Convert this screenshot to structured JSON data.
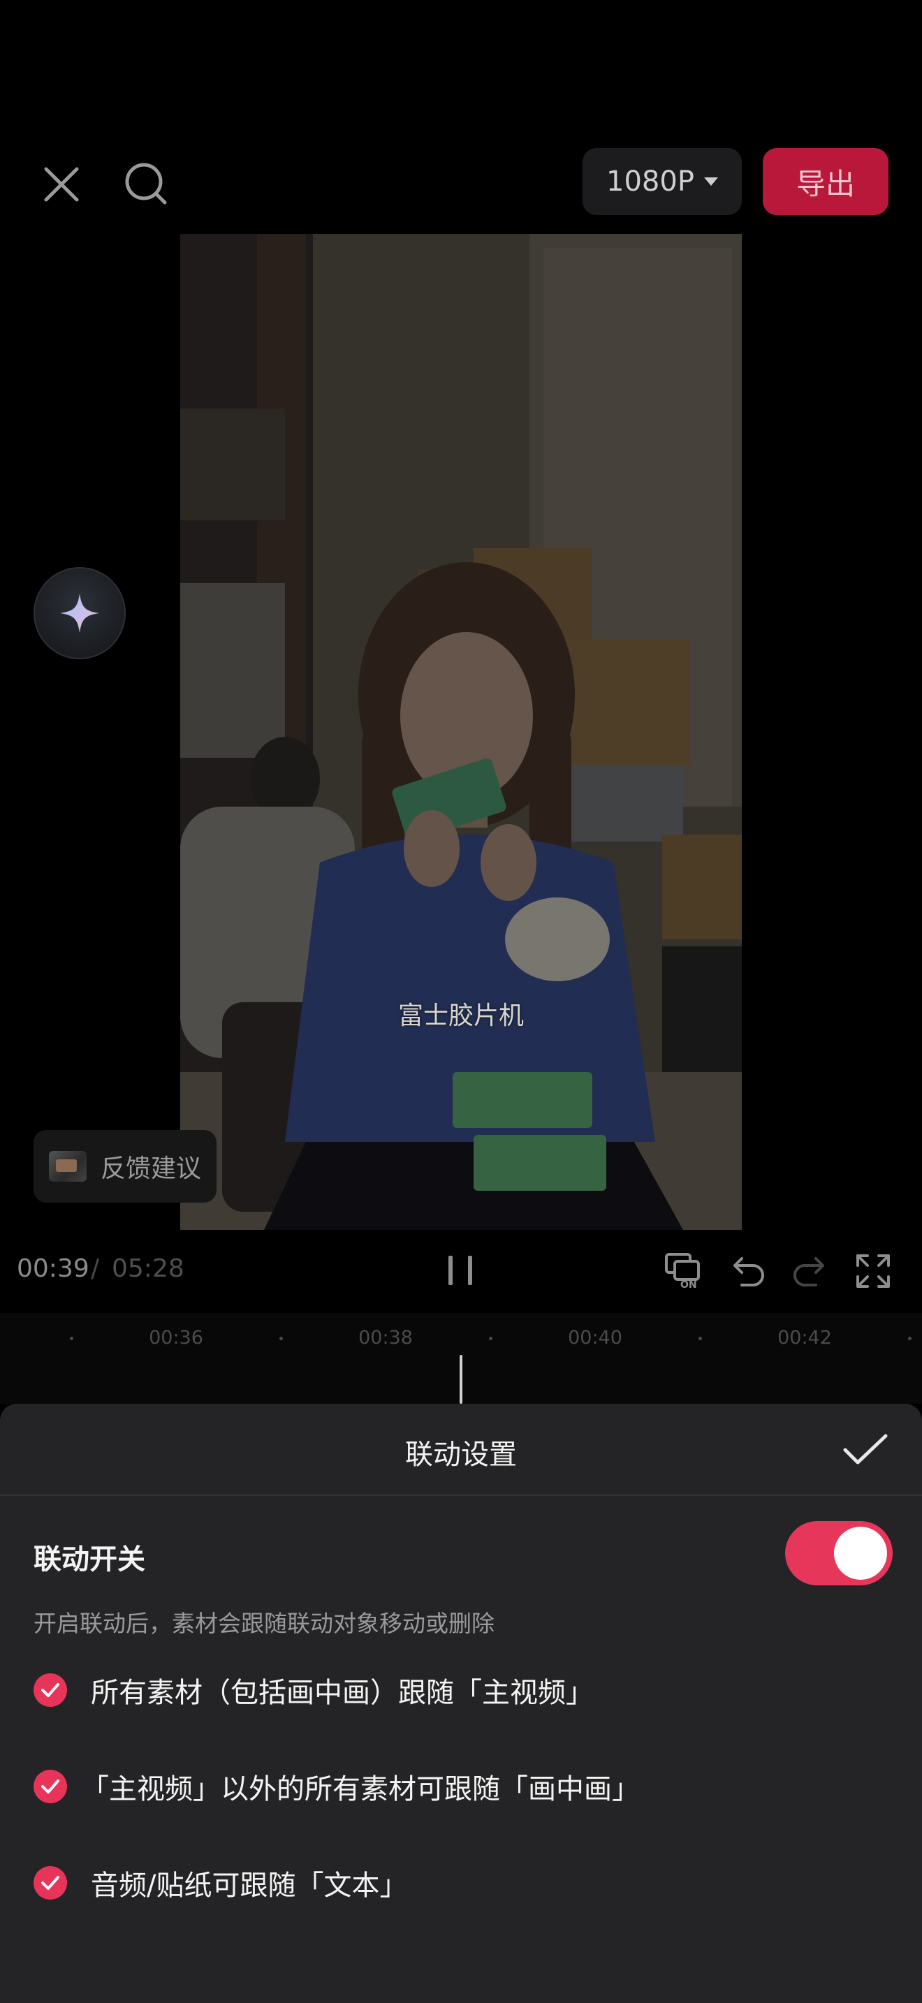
{
  "toolbar": {
    "resolution": "1080P",
    "export_label": "导出",
    "close_icon": "close-icon",
    "search_icon": "search-icon"
  },
  "preview": {
    "subtitle": "富士胶片机",
    "ai_icon": "sparkle-icon",
    "feedback_label": "反馈建议"
  },
  "playback": {
    "current_time": "00:39",
    "separator": "/",
    "total_time": "05:28",
    "icons": [
      "pause-icon",
      "link-on-icon",
      "undo-icon",
      "redo-icon",
      "fullscreen-icon"
    ]
  },
  "timeline": {
    "ticks": [
      "00:36",
      "00:38",
      "00:40",
      "00:42"
    ]
  },
  "sheet": {
    "title": "联动设置",
    "confirm_icon": "checkmark-icon",
    "toggle_label": "联动开关",
    "toggle_on": true,
    "description": "开启联动后，素材会跟随联动对象移动或删除",
    "rules": [
      "所有素材（包括画中画）跟随「主视频」",
      "「主视频」以外的所有素材可跟随「画中画」",
      "音频/贴纸可跟随「文本」"
    ]
  },
  "colors": {
    "accent": "#e6375a",
    "export": "#b9183a",
    "sheet_bg": "#242426"
  }
}
